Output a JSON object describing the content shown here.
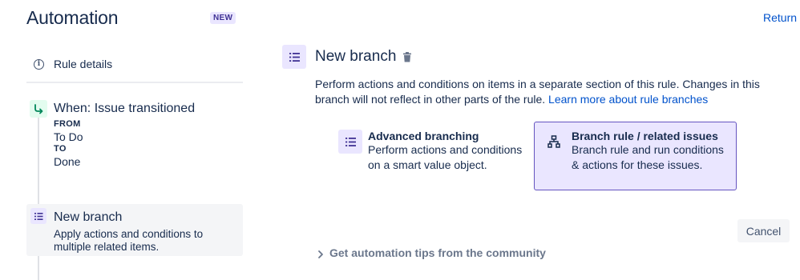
{
  "app": {
    "title": "Automation",
    "badge": "NEW",
    "return_label": "Return"
  },
  "sidebar": {
    "rule_details_label": "Rule details",
    "trigger": {
      "title": "When: Issue transitioned",
      "from_label": "FROM",
      "from_value": "To Do",
      "to_label": "TO",
      "to_value": "Done"
    },
    "branch": {
      "title": "New branch",
      "description": "Apply actions and conditions to multiple related items."
    }
  },
  "main": {
    "title": "New branch",
    "description": "Perform actions and conditions on items in a separate section of this rule. Changes in this branch will not reflect in other parts of the rule.",
    "learn_more_link": "Learn more about rule branches",
    "options": [
      {
        "title": "Advanced branching",
        "description": "Perform actions and conditions on a smart value object.",
        "selected": false
      },
      {
        "title": "Branch rule / related issues",
        "description": "Branch rule and run conditions & actions for these issues.",
        "selected": true
      }
    ],
    "cancel_label": "Cancel",
    "tips_label": "Get automation tips from the community"
  },
  "colors": {
    "text": "#172b4d",
    "link": "#0052cc",
    "selected_bg": "#eae6ff",
    "selected_border": "#6554c0",
    "trigger_icon_bg": "#e3fcef",
    "trigger_icon": "#00875a"
  }
}
